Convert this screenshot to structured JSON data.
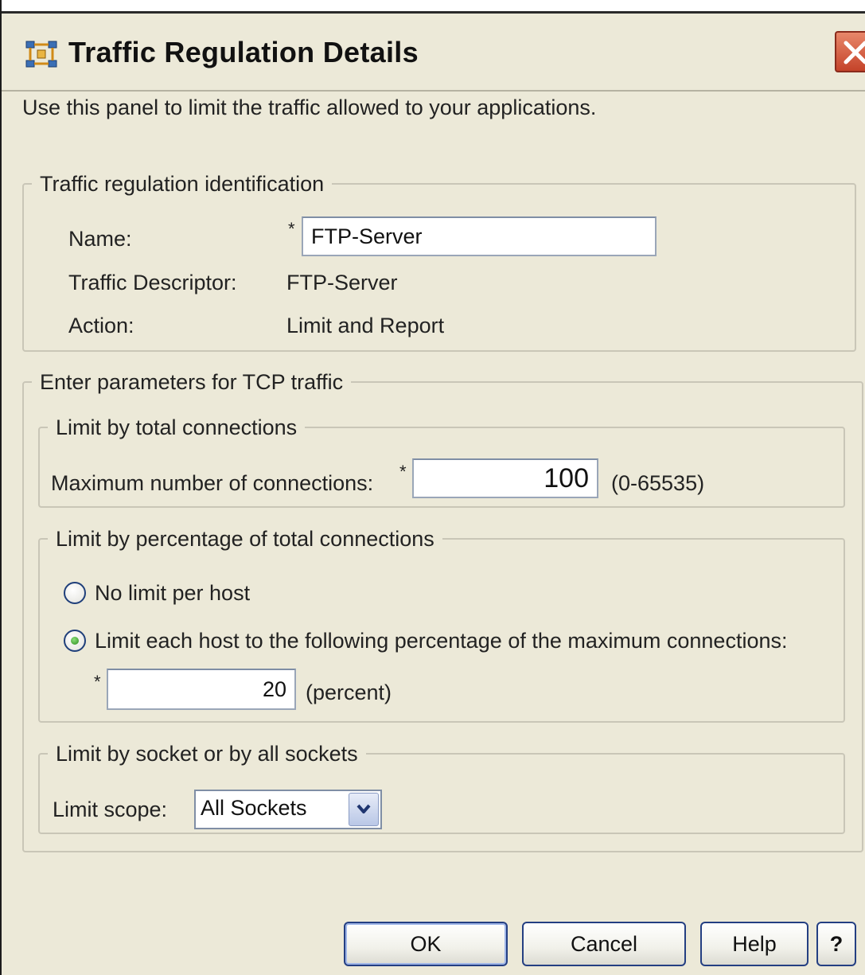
{
  "window": {
    "title": "Traffic Regulation Details",
    "icon": "traffic-regulation-icon",
    "close_icon": "close-icon"
  },
  "intro": "Use this panel to limit the traffic allowed to your applications.",
  "identification": {
    "legend": "Traffic regulation identification",
    "name_label": "Name:",
    "name_required": "*",
    "name_value": "FTP-Server",
    "descriptor_label": "Traffic Descriptor:",
    "descriptor_value": "FTP-Server",
    "action_label": "Action:",
    "action_value": "Limit and Report"
  },
  "tcp": {
    "legend": "Enter parameters for TCP traffic",
    "total": {
      "legend": "Limit by total connections",
      "max_label": "Maximum number of connections:",
      "required": "*",
      "max_value": "100",
      "range": "(0-65535)"
    },
    "percentage": {
      "legend": "Limit by percentage of total connections",
      "option_none": "No limit per host",
      "option_limit": "Limit each host to the following percentage of the maximum connections:",
      "selected": "limit",
      "required": "*",
      "percent_value": "20",
      "percent_unit": "(percent)"
    },
    "socket": {
      "legend": "Limit by socket or by all sockets",
      "scope_label": "Limit scope:",
      "scope_value": "All Sockets"
    }
  },
  "buttons": {
    "ok": "OK",
    "cancel": "Cancel",
    "help": "Help",
    "context_help": "?"
  },
  "colors": {
    "dialog_bg": "#ece9d8",
    "button_border": "#243f82",
    "close_button": "#c4432a"
  }
}
